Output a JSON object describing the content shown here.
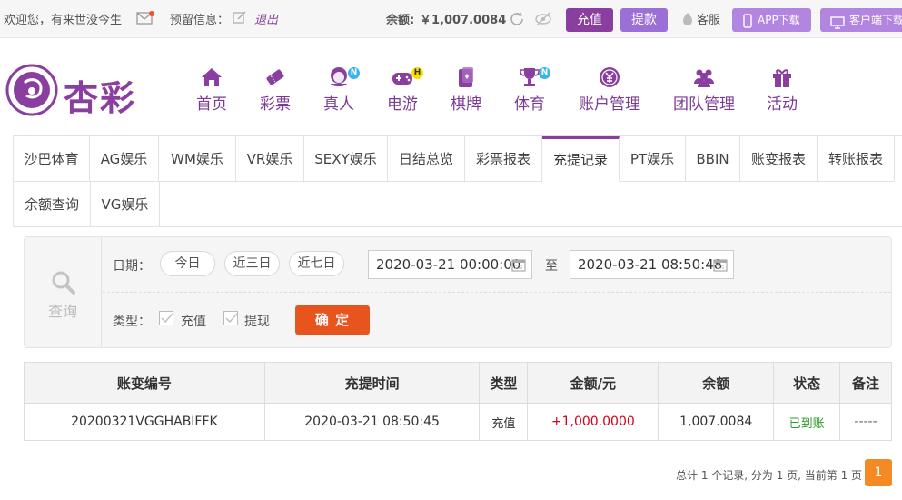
{
  "topbar": {
    "welcome": "欢迎您，",
    "username": "有来世没今生",
    "mail_icon": "mail-icon",
    "reserved_info_label": "预留信息：",
    "logout": "退出",
    "balance_label": "余额:",
    "balance_value": "￥1,007.0084",
    "recharge": "充值",
    "withdraw": "提款",
    "customer_service": "客服",
    "app_download": "APP下载",
    "client_download": "客户端下载"
  },
  "logo": {
    "text": "杏彩"
  },
  "nav": [
    {
      "label": "首页",
      "icon": "home-icon"
    },
    {
      "label": "彩票",
      "icon": "lottery-ticket-icon"
    },
    {
      "label": "真人",
      "icon": "live-dealer-icon",
      "badge": "N"
    },
    {
      "label": "电游",
      "icon": "gamepad-icon",
      "badge": "H"
    },
    {
      "label": "棋牌",
      "icon": "cards-icon"
    },
    {
      "label": "体育",
      "icon": "trophy-icon",
      "badge": "N"
    },
    {
      "label": "账户管理",
      "icon": "yen-coin-icon"
    },
    {
      "label": "团队管理",
      "icon": "team-icon"
    },
    {
      "label": "活动",
      "icon": "gift-icon"
    }
  ],
  "tabs": [
    "沙巴体育",
    "AG娱乐",
    "WM娱乐",
    "VR娱乐",
    "SEXY娱乐",
    "日结总览",
    "彩票报表",
    "充提记录",
    "PT娱乐",
    "BBIN",
    "账变报表",
    "转账报表",
    "余额查询",
    "VG娱乐"
  ],
  "active_tab": "充提记录",
  "filter": {
    "query_label": "查询",
    "date_label": "日期：",
    "quick_ranges": [
      "今日",
      "近三日",
      "近七日"
    ],
    "start_date": "2020-03-21 00:00:00",
    "to_label": "至",
    "end_date": "2020-03-21 08:50:48",
    "type_label": "类型：",
    "types": [
      "充值",
      "提现"
    ],
    "confirm": "确 定"
  },
  "table": {
    "headers": [
      "账变编号",
      "充提时间",
      "类型",
      "金额/元",
      "余额",
      "状态",
      "备注"
    ],
    "rows": [
      {
        "id": "20200321VGGHABIFFK",
        "time": "2020-03-21 08:50:45",
        "type": "充值",
        "amount": "+1,000.0000",
        "balance": "1,007.0084",
        "status": "已到账",
        "note": "-----"
      }
    ]
  },
  "pager": {
    "summary": "总计 1 个记录, 分为 1 页, 当前第 1 页",
    "current_page": "1"
  },
  "colors": {
    "brand": "#8a3fa0",
    "accent": "#f38a25",
    "confirm": "#e8541e",
    "amount": "#d0021b",
    "status_ok": "#2e9a2e"
  }
}
